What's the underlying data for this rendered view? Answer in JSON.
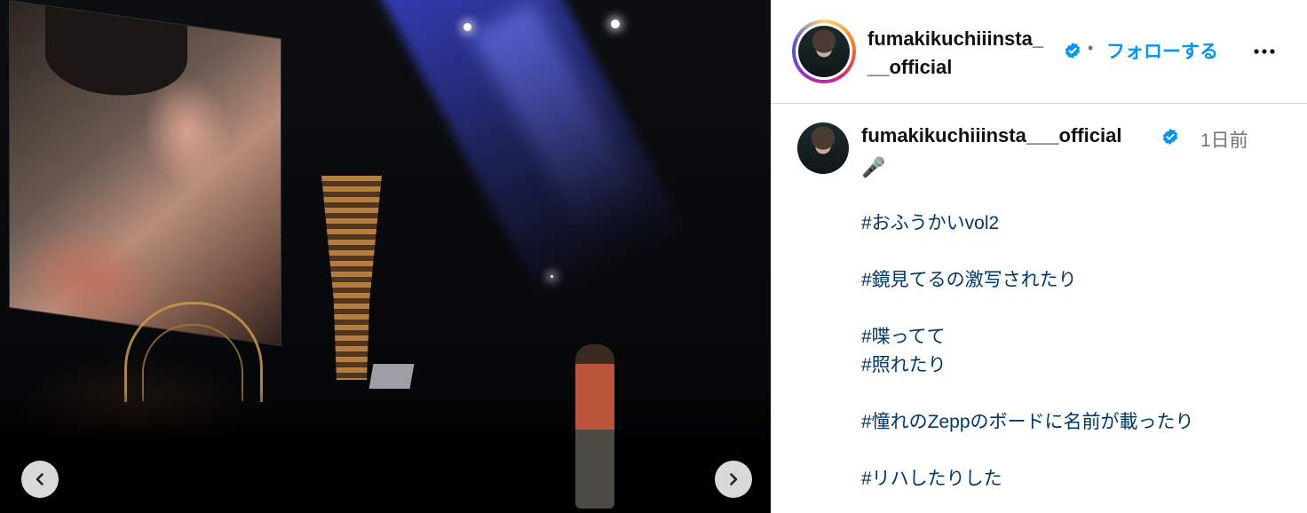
{
  "post": {
    "username": "fumakikuchiiinsta___official",
    "header_username": "fumakikuchiiinsta___official",
    "follow_label": "フォローする",
    "separator": "•",
    "time_ago": "1日前",
    "caption_emoji": "🎤",
    "hashtags": [
      "#おふうかいvol2",
      "#鏡見てるの激写されたり",
      "#喋ってて",
      "#照れたり",
      "#憧れのZeppのボードに名前が載ったり",
      "#リハしたりした"
    ]
  },
  "icons": {
    "prev": "chevron-left-icon",
    "next": "chevron-right-icon",
    "verified": "verified-badge-icon",
    "more": "more-horizontal-icon"
  },
  "colors": {
    "accent": "#0095f6",
    "hashtag": "#00376b",
    "muted": "#737373",
    "verified": "#0095f6"
  }
}
